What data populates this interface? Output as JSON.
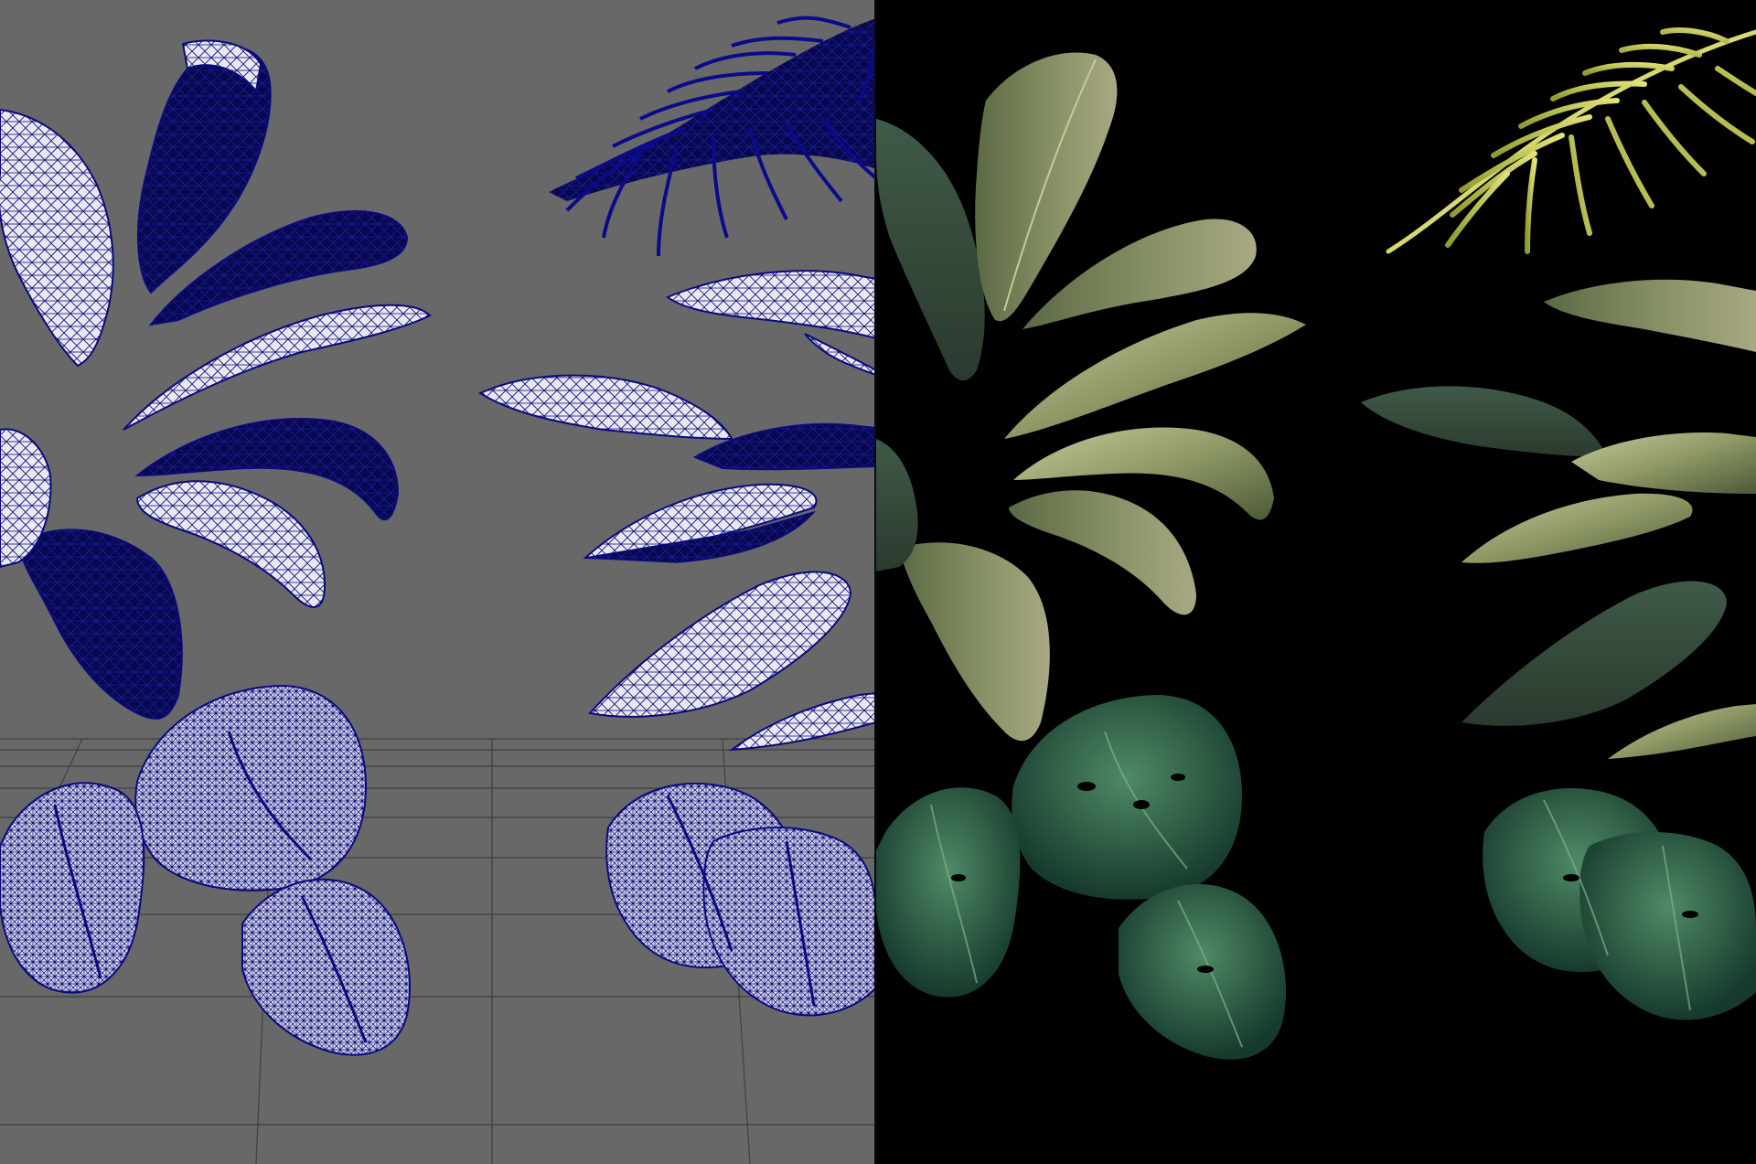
{
  "viewports": [
    {
      "id": "wireframe",
      "shading": "wireframe",
      "background": "#686868",
      "grid_color": "#3d3d3d",
      "wire_color": "#0a0a7e",
      "front_fill": "#e8e8ee",
      "back_fill": "#0a0a5e"
    },
    {
      "id": "rendered",
      "shading": "textured",
      "background": "#000000",
      "colors": {
        "banana_leaf": "#6b7a4a",
        "banana_leaf_lit": "#c8c89a",
        "banana_leaf_dark": "#3d4a2e",
        "palm_frond": "#c9c94a",
        "monstera": "#1f4a3a",
        "monstera_lit": "#3f7a5c"
      }
    }
  ],
  "plants": [
    "palm-frond",
    "banana-leaf",
    "monstera-leaf"
  ]
}
